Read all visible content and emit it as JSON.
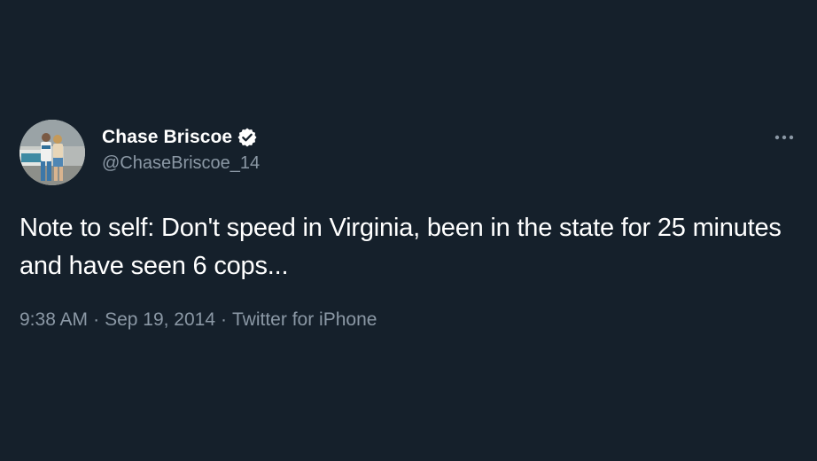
{
  "tweet": {
    "author": {
      "display_name": "Chase Briscoe",
      "handle": "@ChaseBriscoe_14",
      "verified": true
    },
    "text": "Note to self: Don't speed in Virginia, been in the state for 25 minutes and have seen 6 cops...",
    "time": "9:38 AM",
    "date": "Sep 19, 2014",
    "source": "Twitter for iPhone",
    "separator": "·"
  },
  "colors": {
    "background": "#15202b",
    "primary_text": "#ffffff",
    "secondary_text": "#8b98a5",
    "verified_badge": "#ffffff"
  },
  "icons": {
    "verified": "verified-badge-icon",
    "more": "more-options-icon",
    "avatar": "profile-photo"
  }
}
